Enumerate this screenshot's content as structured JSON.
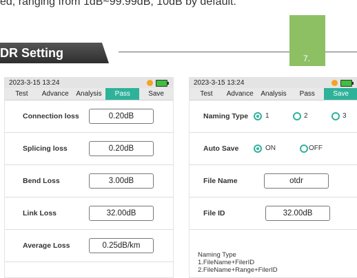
{
  "intro_text": "ed, ranging from 1dB~99.99dB, 10dB by default.",
  "section": {
    "title": "DR Setting",
    "badge": "7."
  },
  "left_screen": {
    "status_time": "2023-3-15 13:24",
    "tabs": [
      "Test",
      "Advance",
      "Analysis",
      "Pass",
      "Save"
    ],
    "active_tab": "Pass",
    "rows": [
      {
        "label": "Connection loss",
        "value": "0.20dB"
      },
      {
        "label": "Splicing loss",
        "value": "0.20dB"
      },
      {
        "label": "Bend Loss",
        "value": "3.00dB"
      },
      {
        "label": "Link Loss",
        "value": "32.00dB"
      },
      {
        "label": "Average Loss",
        "value": "0.25dB/km"
      }
    ]
  },
  "right_screen": {
    "status_time": "2023-3-15 13:24",
    "tabs": [
      "Test",
      "Advance",
      "Analysis",
      "Pass",
      "Save"
    ],
    "active_tab": "Save",
    "naming_type": {
      "label": "Naming Type",
      "options": [
        "1",
        "2",
        "3"
      ],
      "selected": "1"
    },
    "auto_save": {
      "label": "Auto Save",
      "on": "ON",
      "off": "OFF",
      "selected": "ON"
    },
    "file_name": {
      "label": "File Name",
      "value": "otdr"
    },
    "file_id": {
      "label": "File ID",
      "value": "32.00dB"
    },
    "note_lines": [
      "Naming Type",
      "1.FileName+FilerID",
      "2.FileName+Range+FilerID"
    ]
  },
  "colors": {
    "accent": "#2fb29a",
    "badge": "#8dc063",
    "alarm": "#f4a326",
    "battery": "#3fbf3f"
  }
}
